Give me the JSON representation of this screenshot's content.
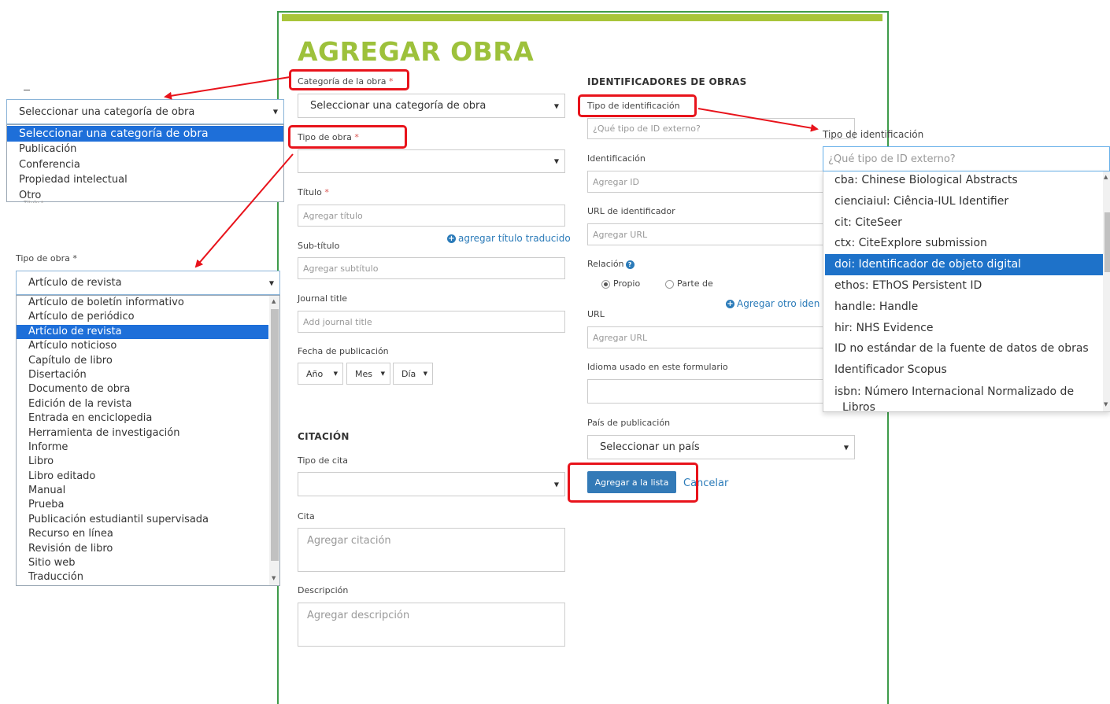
{
  "form": {
    "title": "AGREGAR OBRA",
    "category_label": "Categoría de la obra",
    "required_mark": "*",
    "category_selected": "Seleccionar una categoría de obra",
    "work_type_label": "Tipo de obra",
    "work_type_value": "",
    "title_label": "Título",
    "title_placeholder": "Agregar título",
    "add_translated_title": "agregar título traducido",
    "subtitle_label": "Sub-título",
    "subtitle_placeholder": "Agregar subtítulo",
    "journal_label": "Journal title",
    "journal_placeholder": "Add journal title",
    "pubdate_label": "Fecha de publicación",
    "year": "Año",
    "month": "Mes",
    "day": "Día",
    "citation_header": "CITACIÓN",
    "citation_type_label": "Tipo de cita",
    "citation_label": "Cita",
    "citation_placeholder": "Agregar citación",
    "description_label": "Descripción",
    "description_placeholder": "Agregar descripción"
  },
  "identifiers": {
    "header": "IDENTIFICADORES DE OBRAS",
    "id_type_label": "Tipo de identificación",
    "id_type_placeholder": "¿Qué tipo de ID externo?",
    "id_label": "Identificación",
    "id_placeholder": "Agregar ID",
    "url_id_label": "URL de identificador",
    "url_id_placeholder": "Agregar URL",
    "relation_label": "Relación",
    "relation_own": "Propio",
    "relation_part": "Parte de",
    "add_other_id": "Agregar otro iden",
    "url_label": "URL",
    "url_placeholder": "Agregar URL",
    "language_label": "Idioma usado en este formulario",
    "country_label": "País de publicación",
    "country_selected": "Seleccionar un país",
    "add_button": "Agregar a la lista",
    "cancel_link": "Cancelar"
  },
  "category_dropdown": {
    "selected": "Seleccionar una categoría de obra",
    "options": [
      "Seleccionar una categoría de obra",
      "Publicación",
      "Conferencia",
      "Propiedad intelectual",
      "Otro"
    ],
    "partial_label_below": "Título *"
  },
  "work_type_dropdown": {
    "label": "Tipo de obra",
    "selected": "Artículo de revista",
    "options": [
      "Artículo de boletín informativo",
      "Artículo de periódico",
      "Artículo de revista",
      "Artículo noticioso",
      "Capítulo de libro",
      "Disertación",
      "Documento de obra",
      "Edición de la revista",
      "Entrada en enciclopedia",
      "Herramienta de investigación",
      "Informe",
      "Libro",
      "Libro editado",
      "Manual",
      "Prueba",
      "Publicación estudiantil supervisada",
      "Recurso en línea",
      "Revisión de libro",
      "Sitio web",
      "Traducción"
    ]
  },
  "id_type_dropdown": {
    "label": "Tipo de identificación",
    "placeholder": "¿Qué tipo de ID externo?",
    "options": [
      "cba: Chinese Biological Abstracts",
      "cienciaiul: Ciência-IUL Identifier",
      "cit: CiteSeer",
      "ctx: CiteExplore submission",
      "doi: Identificador de objeto digital",
      "ethos: EThOS Persistent ID",
      "handle: Handle",
      "hir: NHS Evidence",
      "ID no estándar de la fuente de datos de obras",
      "Identificador Scopus",
      "isbn: Número Internacional Normalizado de",
      "Libros"
    ],
    "highlighted": "doi: Identificador de objeto digital"
  },
  "colors": {
    "title_green": "#9dc13b",
    "border_green": "#3e9b4a",
    "annotation_red": "#e8131b",
    "highlight_blue": "#1e6fd9",
    "button_blue": "#337ab7"
  }
}
